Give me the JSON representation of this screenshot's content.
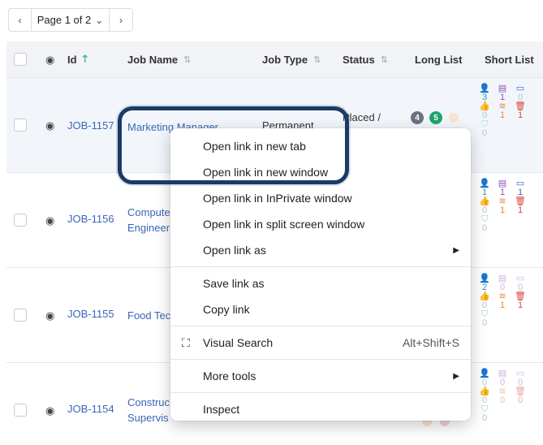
{
  "pager": {
    "prev": "‹",
    "label": "Page 1 of 2",
    "next": "›"
  },
  "columns": {
    "id": "Id",
    "job_name": "Job Name",
    "job_type": "Job Type",
    "status": "Status",
    "long_list": "Long List",
    "short_list": "Short List"
  },
  "rows": [
    {
      "id": "JOB-1157",
      "name_l1": "Marketing Manager",
      "name_l2": "",
      "type": "Permanent",
      "status": "Placed /",
      "badges": [
        "4",
        "5"
      ],
      "sl": {
        "a": [
          "3",
          "1",
          "0"
        ],
        "b": [
          "0",
          "1",
          "1"
        ],
        "c": [
          "0"
        ]
      }
    },
    {
      "id": "JOB-1156",
      "name_l1": "Compute",
      "name_l2": "Engineer",
      "type": "",
      "status": "",
      "sl": {
        "a": [
          "1",
          "1",
          "1"
        ],
        "b": [
          "0",
          "1",
          "1"
        ],
        "c": [
          "0"
        ]
      }
    },
    {
      "id": "JOB-1155",
      "name_l1": "Food Tec",
      "name_l2": "",
      "type": "",
      "status": "",
      "sl": {
        "a": [
          "2",
          "0",
          "0"
        ],
        "b": [
          "0",
          "1",
          "1"
        ],
        "c": [
          "0"
        ]
      }
    },
    {
      "id": "JOB-1154",
      "name_l1": "Construc",
      "name_l2": "Supervis",
      "type": "",
      "status": "",
      "sl": {
        "a": [
          "0",
          "0",
          "0"
        ],
        "b": [
          "0",
          "0",
          "0"
        ],
        "c": [
          "0"
        ]
      }
    }
  ],
  "menu": {
    "open_new_tab": "Open link in new tab",
    "open_new_window": "Open link in new window",
    "open_inprivate": "Open link in InPrivate window",
    "open_split": "Open link in split screen window",
    "open_as": "Open link as",
    "save_link": "Save link as",
    "copy_link": "Copy link",
    "visual_search": "Visual Search",
    "visual_search_shortcut": "Alt+Shift+S",
    "more_tools": "More tools",
    "inspect": "Inspect"
  },
  "colors": {
    "link": "#3a67b5",
    "ring": "#1b3a66",
    "badge_gray": "#6b7280",
    "badge_green": "#1fa66b"
  },
  "icons": {
    "eye": "eye-icon",
    "sort": "sort-icon",
    "sort_up": "sort-up-icon",
    "submenu": "submenu-arrow-icon",
    "visual_search": "visual-search-icon"
  }
}
